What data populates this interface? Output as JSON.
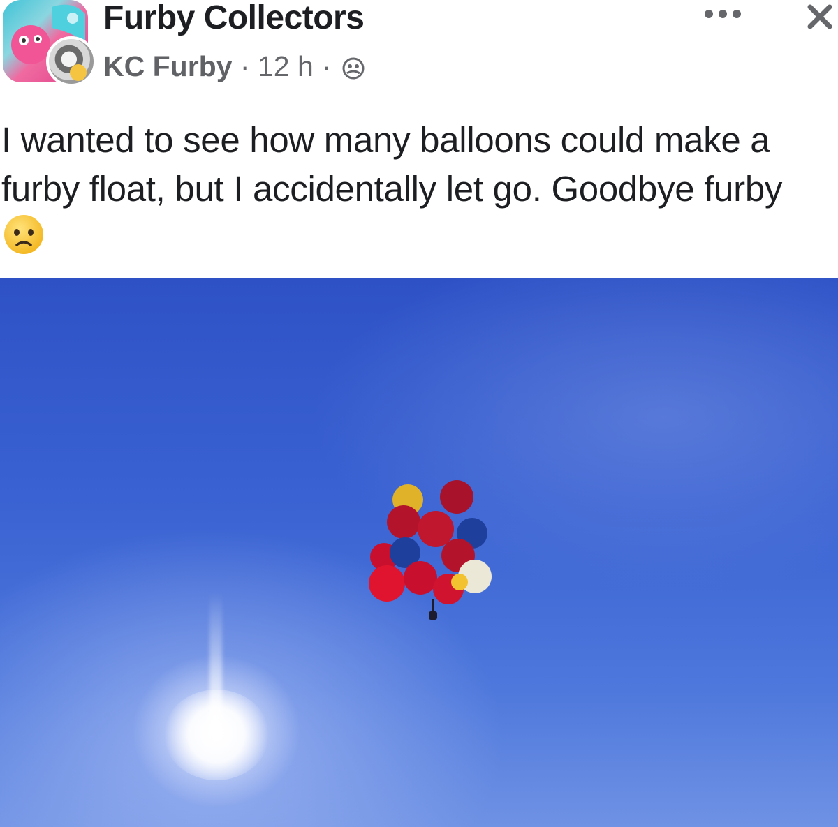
{
  "header": {
    "group_name": "Furby Collectors",
    "author": "KC Furby",
    "separator": "·",
    "time": "12 h",
    "privacy_icon": "group-members-icon",
    "more_icon": "more-options-icon",
    "close_icon": "close-icon"
  },
  "post": {
    "text": "I wanted to see how many balloons could make a furby float, but I accidentally let go. Goodbye furby",
    "emoji": "sad-face-emoji"
  },
  "photo": {
    "subject": "balloon-cluster-in-sky",
    "balloon_colors": [
      "#c8102e",
      "#1f3f9c",
      "#f2c230",
      "#ece8d8"
    ]
  }
}
